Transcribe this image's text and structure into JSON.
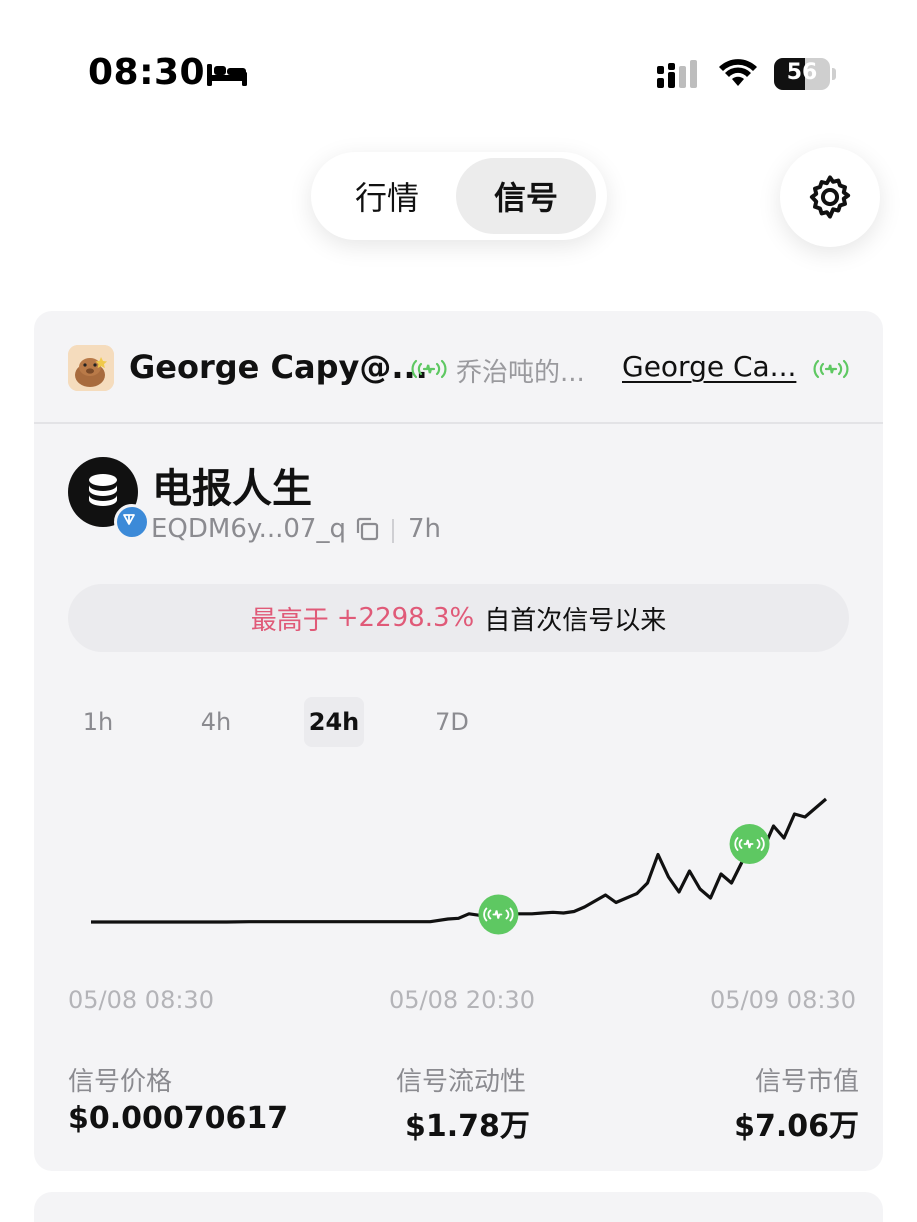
{
  "status_bar": {
    "time": "08:30",
    "focus_icon": "bed-icon",
    "signal_icon": "cellular-signal-icon",
    "wifi_icon": "wifi-icon",
    "battery_level": "56"
  },
  "top_tabs": {
    "market_label": "行情",
    "signal_label": "信号",
    "active": "信号"
  },
  "settings_icon": "gear-icon",
  "signal_card": {
    "sender_name": "George Capy@...",
    "group_name": "乔治吨的...",
    "group_link": "George Ca...",
    "live_icon": "signal-broadcast-icon",
    "token": {
      "name": "电报人生",
      "address": "EQDM6y...07_q",
      "age": "7h",
      "copy_icon": "copy-icon",
      "chain_icon": "ton-icon"
    },
    "gain_banner": {
      "prefix": "最高于",
      "value": "+2298.3%",
      "suffix": "自首次信号以来"
    },
    "ranges": [
      "1h",
      "4h",
      "24h",
      "7D"
    ],
    "active_range": "24h",
    "x_labels": [
      "05/08 08:30",
      "05/08 20:30",
      "05/09 08:30"
    ],
    "stats": {
      "price_label": "信号价格",
      "price_value": "$0.00070617",
      "liquidity_label": "信号流动性",
      "liquidity_value": "$1.78万",
      "mcap_label": "信号市值",
      "mcap_value": "$7.06万"
    }
  },
  "chart_data": {
    "type": "line",
    "series": [
      {
        "values": [
          1.0,
          1.0,
          1.0,
          1.0,
          1.0,
          1.0,
          1.0,
          1.02,
          1.02,
          1.02,
          1.02,
          1.02,
          1.02,
          1.02,
          1.02,
          1.02,
          1.2,
          1.25,
          1.55,
          1.45,
          1.55,
          1.5,
          1.55,
          1.55,
          1.55,
          1.6,
          1.65,
          1.6,
          1.7,
          2.0,
          2.4,
          2.8,
          2.3,
          2.6,
          2.9,
          3.6,
          5.5,
          4.0,
          3.0,
          4.4,
          3.2,
          2.6,
          4.2,
          3.6,
          5.0,
          6.2,
          5.8,
          7.4,
          6.6,
          8.2,
          8.0,
          8.6,
          9.2
        ]
      }
    ],
    "signal_markers": [
      0.4,
      0.86
    ],
    "x_ticks": [
      "05/08 08:30",
      "05/08 20:30",
      "05/09 08:30"
    ],
    "grid": false,
    "line_color": "#111111",
    "marker_color": "#5ec862"
  }
}
